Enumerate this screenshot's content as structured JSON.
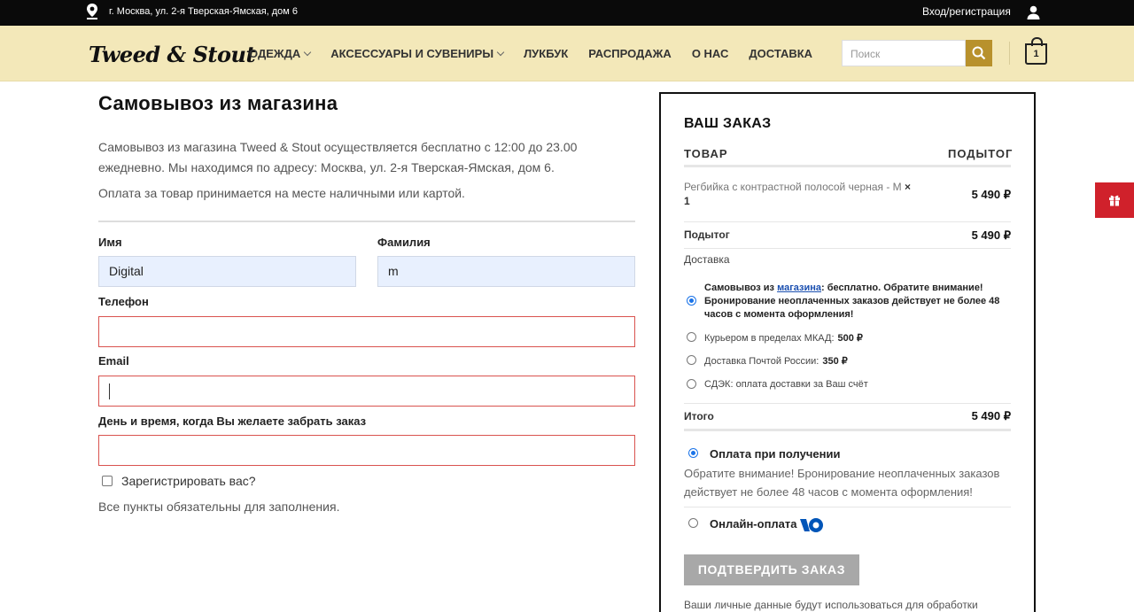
{
  "topbar": {
    "address": "г. Москва, ул. 2-я Тверская-Ямская, дом 6",
    "login": "Вход/регистрация"
  },
  "header": {
    "logo": "Tweed & Stout",
    "nav": [
      {
        "label": "ОДЕЖДА",
        "has_dropdown": true
      },
      {
        "label": "АКСЕССУАРЫ И СУВЕНИРЫ",
        "has_dropdown": true
      },
      {
        "label": "ЛУКБУК",
        "has_dropdown": false
      },
      {
        "label": "РАСПРОДАЖА",
        "has_dropdown": false
      },
      {
        "label": "О НАС",
        "has_dropdown": false
      },
      {
        "label": "ДОСТАВКА",
        "has_dropdown": false
      }
    ],
    "search_placeholder": "Поиск",
    "cart_count": "1"
  },
  "checkout": {
    "title": "Самовывоз из магазина",
    "intro": "Самовывоз из магазина Tweed & Stout осуществляется бесплатно с 12:00 до 23.00 ежедневно. Мы находимся по адресу: Москва, ул. 2-я Тверская-Ямская, дом 6.",
    "payment_info": "Оплата за товар принимается на месте наличными или картой.",
    "first_name_label": "Имя",
    "first_name_value": "Digital",
    "last_name_label": "Фамилия",
    "last_name_value": "m",
    "phone_label": "Телефон",
    "phone_value": "",
    "email_label": "Email",
    "email_value": "",
    "pickup_time_label": "День и время, когда Вы желаете забрать заказ",
    "pickup_time_value": "",
    "register_label": "Зарегистрировать вас?",
    "required_note": "Все пункты обязательны для заполнения."
  },
  "order": {
    "title": "ВАШ ЗАКАЗ",
    "col_product": "ТОВАР",
    "col_subtotal": "ПОДЫТОГ",
    "item_name": "Регбийка с контрастной полосой черная - М",
    "item_qty": "× 1",
    "item_price": "5 490 ₽",
    "subtotal_label": "Подытог",
    "subtotal_value": "5 490 ₽",
    "shipping_label": "Доставка",
    "shipping_selected_prefix": "Самовывоз из ",
    "shipping_selected_link": "магазина",
    "shipping_selected_suffix": ": бесплатно. Обратите внимание! Бронирование неоплаченных заказов действует не более 48 часов с момента оформления!",
    "shipping_options": [
      {
        "label": "Курьером в пределах МКАД:",
        "price": "500 ₽"
      },
      {
        "label": "Доставка Почтой России:",
        "price": "350 ₽"
      },
      {
        "label": "СДЭК: оплата доставки за Ваш счёт",
        "price": ""
      }
    ],
    "total_label": "Итого",
    "total_value": "5 490 ₽",
    "pay_on_delivery": "Оплата при получении",
    "pay_on_delivery_desc": "Обратите внимание! Бронирование неоплаченных заказов действует не более 48 часов с момента оформления!",
    "pay_online": "Онлайн-оплата",
    "confirm_button": "ПОДТВЕРДИТЬ ЗАКАЗ",
    "privacy_note": "Ваши личные данные будут использоваться для обработки"
  },
  "colors": {
    "header_bg": "#f3e8b9",
    "accent": "#b8912c",
    "error": "#d9534f",
    "gift": "#d0212b"
  }
}
